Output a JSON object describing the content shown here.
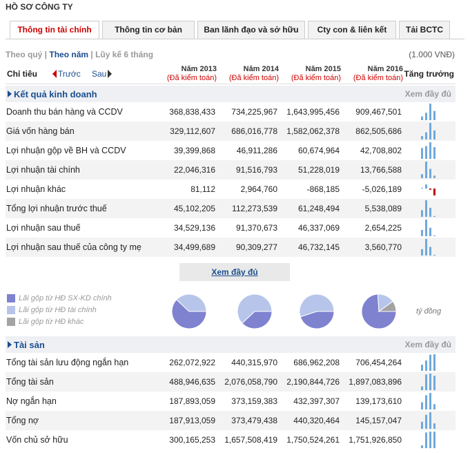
{
  "title": "HỒ SƠ CÔNG TY",
  "tabs": [
    {
      "label": "Thông tin tài chính",
      "active": true
    },
    {
      "label": "Thông tin cơ bản"
    },
    {
      "label": "Ban lãnh đạo và sở hữu"
    },
    {
      "label": "Cty con & liên kết"
    },
    {
      "label": "Tải BCTC"
    }
  ],
  "period": {
    "quarter": "Theo quý",
    "sep1": " | ",
    "year": "Theo năm",
    "sep2": " | ",
    "cumulative": "Lũy kế 6 tháng"
  },
  "unit": "(1.000 VNĐ)",
  "header": {
    "label": "Chỉ tiêu",
    "prev": "Trước",
    "next": "Sau",
    "years": [
      "Năm 2013",
      "Năm 2014",
      "Năm 2015",
      "Năm 2016"
    ],
    "audited": "(Đã kiểm toán)",
    "growth": "Tăng trưởng"
  },
  "colors": {
    "accent": "#1a4d8f",
    "negative": "#c00000",
    "spark": "#6fa8dc",
    "pie_main": "#7f82cf",
    "pie_fin": "#b7c5ea",
    "pie_other": "#a3a3a3"
  },
  "section1": {
    "name": "Kết quả kinh doanh",
    "more": "Xem đầy đủ"
  },
  "rows1": [
    {
      "label": "Doanh thu bán hàng và CCDV",
      "values": [
        "368,838,433",
        "734,225,967",
        "1,643,995,456",
        "909,467,501"
      ],
      "nums": [
        368838433,
        734225967,
        1643995456,
        909467501
      ]
    },
    {
      "label": "Giá vốn hàng bán",
      "values": [
        "329,112,607",
        "686,016,778",
        "1,582,062,378",
        "862,505,686"
      ],
      "nums": [
        329112607,
        686016778,
        1582062378,
        862505686
      ]
    },
    {
      "label": "Lợi nhuận gộp về BH và CCDV",
      "values": [
        "39,399,868",
        "46,911,286",
        "60,674,964",
        "42,708,802"
      ],
      "nums": [
        39399868,
        46911286,
        60674964,
        42708802
      ]
    },
    {
      "label": "Lợi nhuận tài chính",
      "values": [
        "22,046,316",
        "91,516,793",
        "51,228,019",
        "13,766,588"
      ],
      "nums": [
        22046316,
        91516793,
        51228019,
        13766588
      ]
    },
    {
      "label": "Lợi nhuận khác",
      "values": [
        "81,112",
        "2,964,760",
        "-868,185",
        "-5,026,189"
      ],
      "nums": [
        81112,
        2964760,
        -868185,
        -5026189
      ]
    },
    {
      "label": "Tổng lợi nhuận trước thuế",
      "values": [
        "45,102,205",
        "112,273,539",
        "61,248,494",
        "5,538,089"
      ],
      "nums": [
        45102205,
        112273539,
        61248494,
        5538089
      ]
    },
    {
      "label": "Lợi nhuận sau thuế",
      "values": [
        "34,529,136",
        "91,370,673",
        "46,337,069",
        "2,654,225"
      ],
      "nums": [
        34529136,
        91370673,
        46337069,
        2654225
      ]
    },
    {
      "label": "Lợi nhuận sau thuế của công ty mẹ",
      "values": [
        "34,499,689",
        "90,309,277",
        "46,732,145",
        "3,560,770"
      ],
      "nums": [
        34499689,
        90309277,
        46732145,
        3560770
      ]
    }
  ],
  "more_button": "Xem đầy đủ",
  "legend": [
    {
      "label": "Lãi gộp từ HĐ SX-KD chính"
    },
    {
      "label": "Lãi gộp từ HĐ tài chính"
    },
    {
      "label": "Lãi gộp từ HĐ khác"
    }
  ],
  "pie_unit": "tỷ đồng",
  "pies": [
    [
      0.62,
      0.38,
      0.0
    ],
    [
      0.38,
      0.62,
      0.0
    ],
    [
      0.45,
      0.55,
      0.0
    ],
    [
      0.74,
      0.16,
      0.1
    ]
  ],
  "section2": {
    "name": "Tài sản",
    "more": "Xem đầy đủ"
  },
  "rows2": [
    {
      "label": "Tổng tài sản lưu động ngắn hạn",
      "values": [
        "262,072,922",
        "440,315,970",
        "686,962,208",
        "706,454,264"
      ],
      "nums": [
        262072922,
        440315970,
        686962208,
        706454264
      ]
    },
    {
      "label": "Tổng tài sản",
      "values": [
        "488,946,635",
        "2,076,058,790",
        "2,190,844,726",
        "1,897,083,896"
      ],
      "nums": [
        488946635,
        2076058790,
        2190844726,
        1897083896
      ]
    },
    {
      "label": "Nợ ngắn hạn",
      "values": [
        "187,893,059",
        "373,159,383",
        "432,397,307",
        "139,173,610"
      ],
      "nums": [
        187893059,
        373159383,
        432397307,
        139173610
      ]
    },
    {
      "label": "Tổng nợ",
      "values": [
        "187,913,059",
        "373,479,438",
        "440,320,464",
        "145,157,047"
      ],
      "nums": [
        187913059,
        373479438,
        440320464,
        145157047
      ]
    },
    {
      "label": "Vốn chủ sở hữu",
      "values": [
        "300,165,253",
        "1,657,508,419",
        "1,750,524,261",
        "1,751,926,850"
      ],
      "nums": [
        300165253,
        1657508419,
        1750524261,
        1751926850
      ]
    }
  ]
}
